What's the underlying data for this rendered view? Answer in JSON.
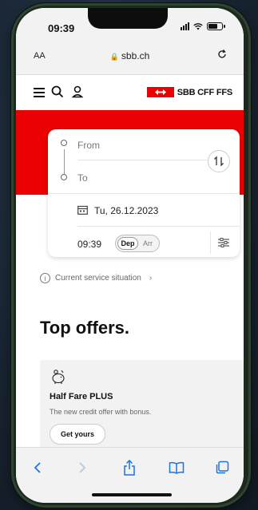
{
  "status": {
    "time": "09:39"
  },
  "browser": {
    "aa_label": "AA",
    "url": "sbb.ch"
  },
  "header": {
    "logo_text": "SBB CFF FFS"
  },
  "planner": {
    "from_placeholder": "From",
    "to_placeholder": "To",
    "date": "Tu, 26.12.2023",
    "time": "09:39",
    "dep_label": "Dep",
    "arr_label": "Arr"
  },
  "service": {
    "label": "Current service situation"
  },
  "offers": {
    "heading": "Top offers.",
    "card_title": "Half Fare PLUS",
    "card_subtitle": "The new credit offer with bonus.",
    "card_button": "Get yours"
  },
  "colors": {
    "brand_red": "#eb0000",
    "ios_blue": "#1a73e8"
  },
  "icons": [
    "menu-icon",
    "search-icon",
    "user-icon",
    "swap-icon",
    "calendar-icon",
    "filter-icon",
    "info-icon",
    "piggy-bank-icon",
    "back-icon",
    "forward-icon",
    "share-icon",
    "bookmarks-icon",
    "tabs-icon"
  ]
}
